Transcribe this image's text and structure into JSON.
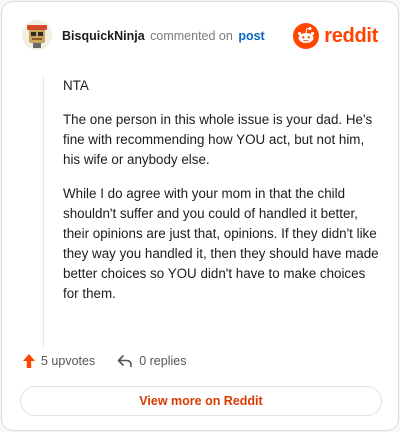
{
  "comment": {
    "username": "BisquickNinja",
    "action_text": "commented on",
    "post_link": "post",
    "paragraphs": [
      "NTA",
      "The one person in this whole issue is your dad. He's fine with recommending how YOU act, but not him, his wife or anybody else.",
      "While I do agree with your mom in that the child shouldn't suffer and you could of handled it better, their opinions are just that, opinions. If they didn't like they way you handled it, then they should have made better choices so YOU didn't have to make choices for them."
    ]
  },
  "brand": {
    "wordmark": "reddit",
    "icon": "reddit-snoo-icon",
    "color": "#ff4500"
  },
  "footer": {
    "upvotes_label": "5 upvotes",
    "replies_label": "0 replies",
    "upvote_icon": "upvote-arrow-icon",
    "reply_icon": "reply-arrow-icon"
  },
  "view_more_label": "View more on Reddit",
  "colors": {
    "accent": "#ff4500",
    "link": "#0a66c2",
    "button_text": "#d93a00"
  }
}
